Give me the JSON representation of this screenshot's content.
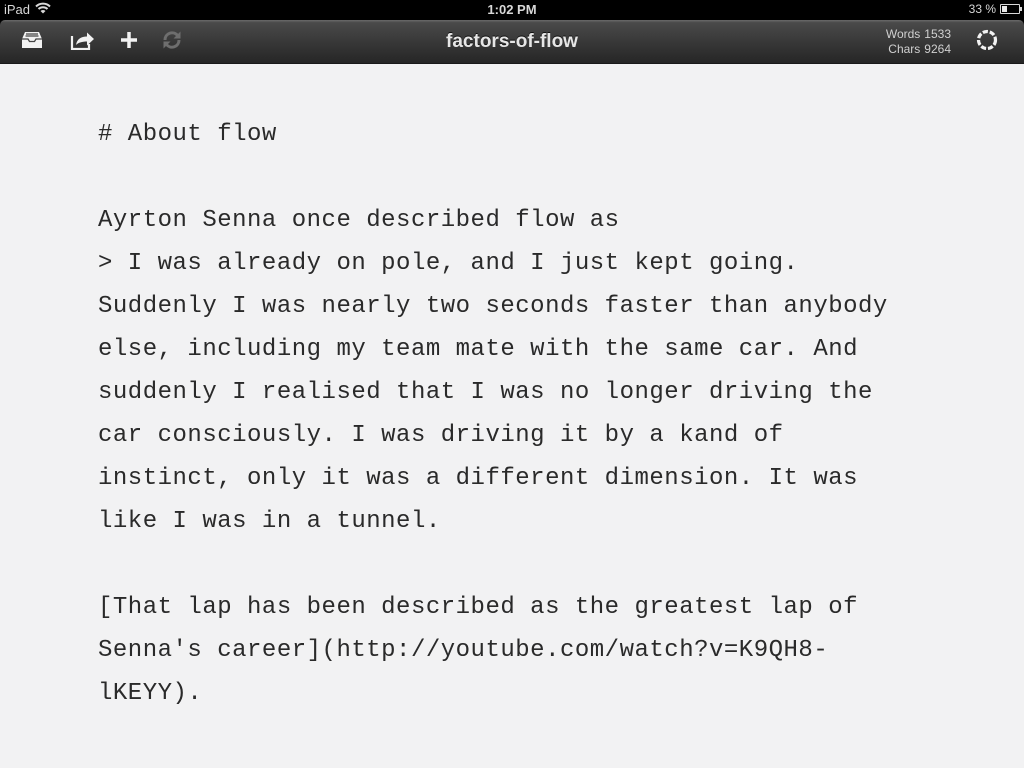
{
  "status_bar": {
    "carrier": "iPad",
    "time": "1:02 PM",
    "battery_percent_label": "33 %",
    "battery_level": 0.33
  },
  "toolbar": {
    "title": "factors-of-flow",
    "buttons": [
      {
        "icon": "inbox-icon",
        "label": "Documents"
      },
      {
        "icon": "share-icon",
        "label": "Share"
      },
      {
        "icon": "plus-icon",
        "label": "New"
      },
      {
        "icon": "sync-icon",
        "label": "Sync"
      }
    ],
    "stats": {
      "words_label": "Words",
      "words_value": "1533",
      "chars_label": "Chars",
      "chars_value": "9264"
    },
    "focus_button_icon": "dashed-circle-icon"
  },
  "editor": {
    "lines": [
      "# About flow",
      "",
      "Ayrton Senna once described flow as",
      "> I was already on pole, and I just kept going.",
      "Suddenly I was nearly two seconds faster than anybody",
      "else, including my team mate with the same car. And",
      "suddenly I realised that I was no longer driving the",
      "car consciously. I was driving it by a kand of",
      "instinct, only it was a different dimension. It was",
      "like I was in a tunnel.",
      "",
      "[That lap has been described as the greatest lap of",
      "Senna's career](http://youtube.com/watch?v=K9QH8-",
      "lKEYY)."
    ]
  }
}
